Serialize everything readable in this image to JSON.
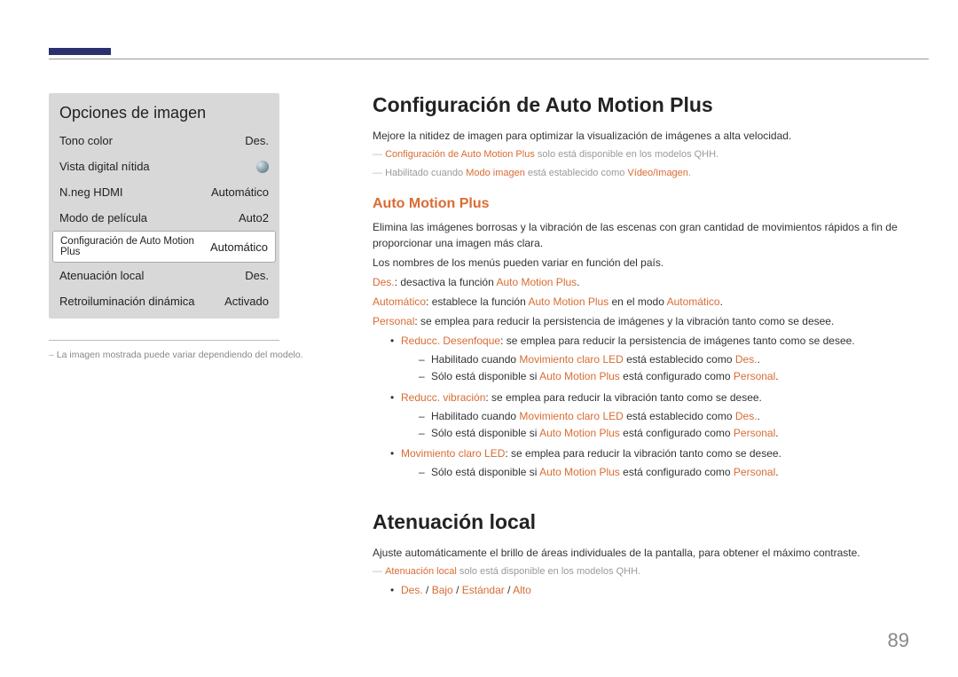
{
  "pageNumber": "89",
  "leftNote": "La imagen mostrada puede variar dependiendo del modelo.",
  "menu": {
    "title": "Opciones de imagen",
    "items": [
      {
        "label": "Tono color",
        "value": "Des.",
        "hasToggle": false
      },
      {
        "label": "Vista digital nítida",
        "value": "",
        "hasToggle": true
      },
      {
        "label": "N.neg HDMI",
        "value": "Automático",
        "hasToggle": false
      },
      {
        "label": "Modo de película",
        "value": "Auto2",
        "hasToggle": false
      },
      {
        "label": "Configuración de Auto Motion Plus",
        "value": "Automático",
        "hasToggle": false,
        "highlight": true
      },
      {
        "label": "Atenuación local",
        "value": "Des.",
        "hasToggle": false
      },
      {
        "label": "Retroiluminación dinámica",
        "value": "Activado",
        "hasToggle": false
      }
    ]
  },
  "section1": {
    "heading": "Configuración de Auto Motion Plus",
    "intro": "Mejore la nitidez de imagen para optimizar la visualización de imágenes a alta velocidad.",
    "note1a": "Configuración de Auto Motion Plus",
    "note1b": " solo está disponible en los modelos QHH.",
    "note2a": "Habilitado cuando ",
    "note2b": "Modo imagen",
    "note2c": " está establecido como ",
    "note2d": "Vídeo/Imagen",
    "subheading": "Auto Motion Plus",
    "p1": "Elimina las imágenes borrosas y la vibración de las escenas con gran cantidad de movimientos rápidos a fin de proporcionar una imagen más clara.",
    "p2": "Los nombres de los menús pueden variar en función del país.",
    "des_a": "Des.",
    "des_b": ": desactiva la función ",
    "des_c": "Auto Motion Plus",
    "auto_a": "Automático",
    "auto_b": ": establece la función ",
    "auto_c": "Auto Motion Plus",
    "auto_d": " en el modo ",
    "auto_e": "Automático",
    "pers_a": "Personal",
    "pers_b": ": se emplea para reducir la persistencia de imágenes y la vibración tanto como se desee.",
    "b1_a": "Reducc. Desenfoque",
    "b1_b": ": se emplea para reducir la persistencia de imágenes tanto como se desee.",
    "d1_a": "Habilitado cuando ",
    "d1_b": "Movimiento claro LED",
    "d1_c": " está establecido como ",
    "d1_d": "Des.",
    "d2_a": "Sólo está disponible si ",
    "d2_b": "Auto Motion Plus",
    "d2_c": " está configurado como ",
    "d2_d": "Personal",
    "b2_a": "Reducc. vibración",
    "b2_b": ": se emplea para reducir la vibración tanto como se desee.",
    "d3_a": "Habilitado cuando ",
    "d3_b": "Movimiento claro LED",
    "d3_c": " está establecido como ",
    "d3_d": "Des.",
    "d4_a": "Sólo está disponible si ",
    "d4_b": "Auto Motion Plus",
    "d4_c": " está configurado como ",
    "d4_d": "Personal",
    "b3_a": "Movimiento claro LED",
    "b3_b": ": se emplea para reducir la vibración tanto como se desee.",
    "d5_a": "Sólo está disponible si ",
    "d5_b": "Auto Motion Plus",
    "d5_c": " está configurado como ",
    "d5_d": "Personal"
  },
  "section2": {
    "heading": "Atenuación local",
    "p1": "Ajuste automáticamente el brillo de áreas individuales de la pantalla, para obtener el máximo contraste.",
    "note_a": "Atenuación local",
    "note_b": " solo está disponible en los modelos QHH.",
    "opts_a": "Des.",
    "opts_b": "Bajo",
    "opts_c": "Estándar",
    "opts_d": "Alto"
  }
}
